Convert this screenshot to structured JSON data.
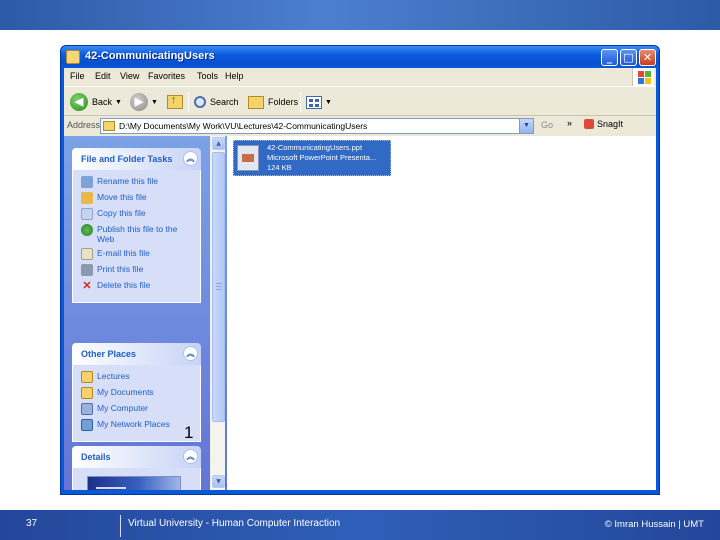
{
  "slide": {
    "page_number": "37",
    "course": "Virtual University - Human Computer Interaction",
    "credit": "© Imran Hussain | UMT",
    "callout_number": "1"
  },
  "window": {
    "title": "42-CommunicatingUsers",
    "controls": {
      "minimize": "_",
      "maximize": "□",
      "close": "✕"
    }
  },
  "menu": [
    "File",
    "Edit",
    "View",
    "Favorites",
    "Tools",
    "Help"
  ],
  "toolbar": {
    "back_label": "Back",
    "search_label": "Search",
    "folders_label": "Folders"
  },
  "address": {
    "label": "Address",
    "path": "D:\\My Documents\\My Work\\VU\\Lectures\\42-CommunicatingUsers",
    "go_label": "Go",
    "links_label": "»",
    "snagit_label": "SnagIt"
  },
  "tasks_panel": {
    "title": "File and Folder Tasks",
    "items": [
      {
        "label": "Rename this file",
        "icon": "rename-icon"
      },
      {
        "label": "Move this file",
        "icon": "move-icon"
      },
      {
        "label": "Copy this file",
        "icon": "copy-icon"
      },
      {
        "label": "Publish this file to the Web",
        "icon": "globe-icon"
      },
      {
        "label": "E-mail this file",
        "icon": "email-icon"
      },
      {
        "label": "Print this file",
        "icon": "printer-icon"
      },
      {
        "label": "Delete this file",
        "icon": "delete-icon"
      }
    ]
  },
  "places_panel": {
    "title": "Other Places",
    "items": [
      {
        "label": "Lectures",
        "icon": "folder-icon"
      },
      {
        "label": "My Documents",
        "icon": "my-documents-icon"
      },
      {
        "label": "My Computer",
        "icon": "computer-icon"
      },
      {
        "label": "My Network Places",
        "icon": "network-icon"
      }
    ]
  },
  "details_panel": {
    "title": "Details"
  },
  "file": {
    "name": "42-CommunicatingUsers.ppt",
    "type": "Microsoft PowerPoint Presenta...",
    "size": "124 KB"
  },
  "colors": {
    "xp_blue": "#0a57d8",
    "task_link": "#215dc6",
    "selection": "#316ac5"
  }
}
